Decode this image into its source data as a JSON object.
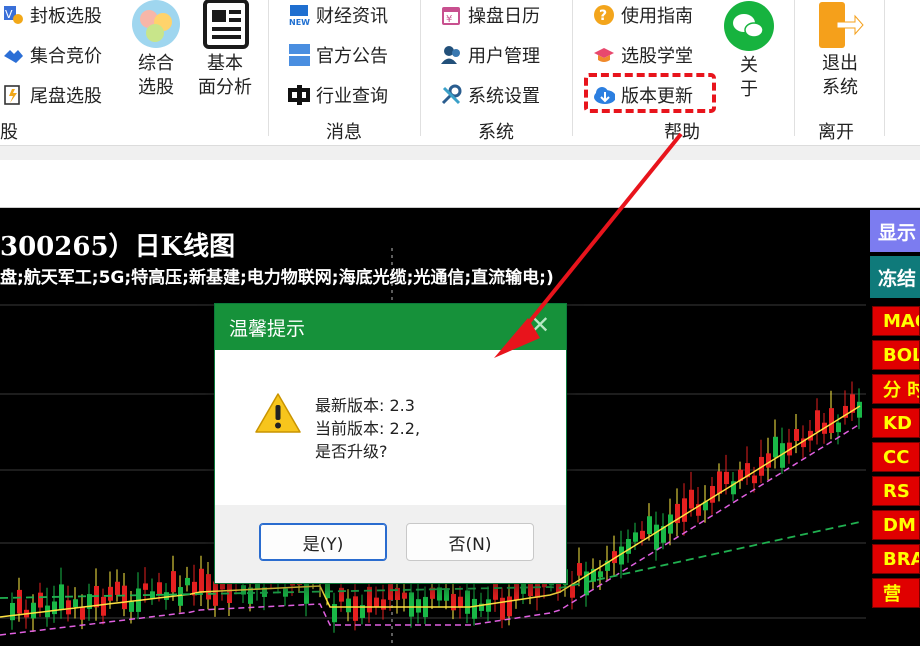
{
  "ribbon": {
    "group1": {
      "items": [
        {
          "label": "封板选股",
          "icon": "seal-icon"
        },
        {
          "label": "集合竞价",
          "icon": "handshake-icon"
        },
        {
          "label": "尾盘选股",
          "icon": "late-market-icon"
        }
      ],
      "group_label": "股"
    },
    "big_buttons": [
      {
        "label_lines": [
          "综合",
          "选股"
        ],
        "icon": "circles-icon"
      },
      {
        "label_lines": [
          "基本",
          "面分析"
        ],
        "icon": "document-icon"
      }
    ],
    "messages": {
      "items": [
        {
          "label": "财经资讯",
          "icon": "news-icon"
        },
        {
          "label": "官方公告",
          "icon": "announcement-icon"
        },
        {
          "label": "行业查询",
          "icon": "industry-icon"
        }
      ],
      "group_label": "消息"
    },
    "system": {
      "items": [
        {
          "label": "操盘日历",
          "icon": "calendar-icon"
        },
        {
          "label": "用户管理",
          "icon": "users-icon"
        },
        {
          "label": "系统设置",
          "icon": "tools-icon"
        }
      ],
      "group_label": "系统"
    },
    "help": {
      "items": [
        {
          "label": "使用指南",
          "icon": "question-icon"
        },
        {
          "label": "选股学堂",
          "icon": "graduation-cap-icon"
        },
        {
          "label": "版本更新",
          "icon": "cloud-download-icon"
        }
      ],
      "about_lines": [
        "关",
        "于"
      ],
      "group_label": "帮助"
    },
    "leave": {
      "exit_lines": [
        "退出",
        "系统"
      ],
      "group_label": "离开"
    }
  },
  "chart": {
    "title": "300265）日K线图",
    "subtitle": "盘;航天军工;5G;特高压;新基建;电力物联网;海底光缆;光通信;直流输电;)"
  },
  "side_panel": {
    "top_buttons": [
      "显示",
      "冻结"
    ],
    "indicators": [
      "MAC",
      "BOL",
      "分 时",
      "KD",
      "CC",
      "RS",
      "DM",
      "BRA",
      "营"
    ]
  },
  "dialog": {
    "title": "温馨提示",
    "latest_version_label": "最新版本:",
    "latest_version": "2.3",
    "current_version_label": "当前版本:",
    "current_version": "2.2,",
    "question": "是否升级?",
    "yes_label": "是(Y)",
    "no_label": "否(N)"
  },
  "colors": {
    "ribbon_bg": "#ffffff",
    "dialog_header": "#16913a",
    "highlight": "#e8141c",
    "indicator_bg": "#e00000",
    "indicator_text": "#ffff00",
    "candle_up": "#e52020",
    "candle_down": "#19b847"
  }
}
